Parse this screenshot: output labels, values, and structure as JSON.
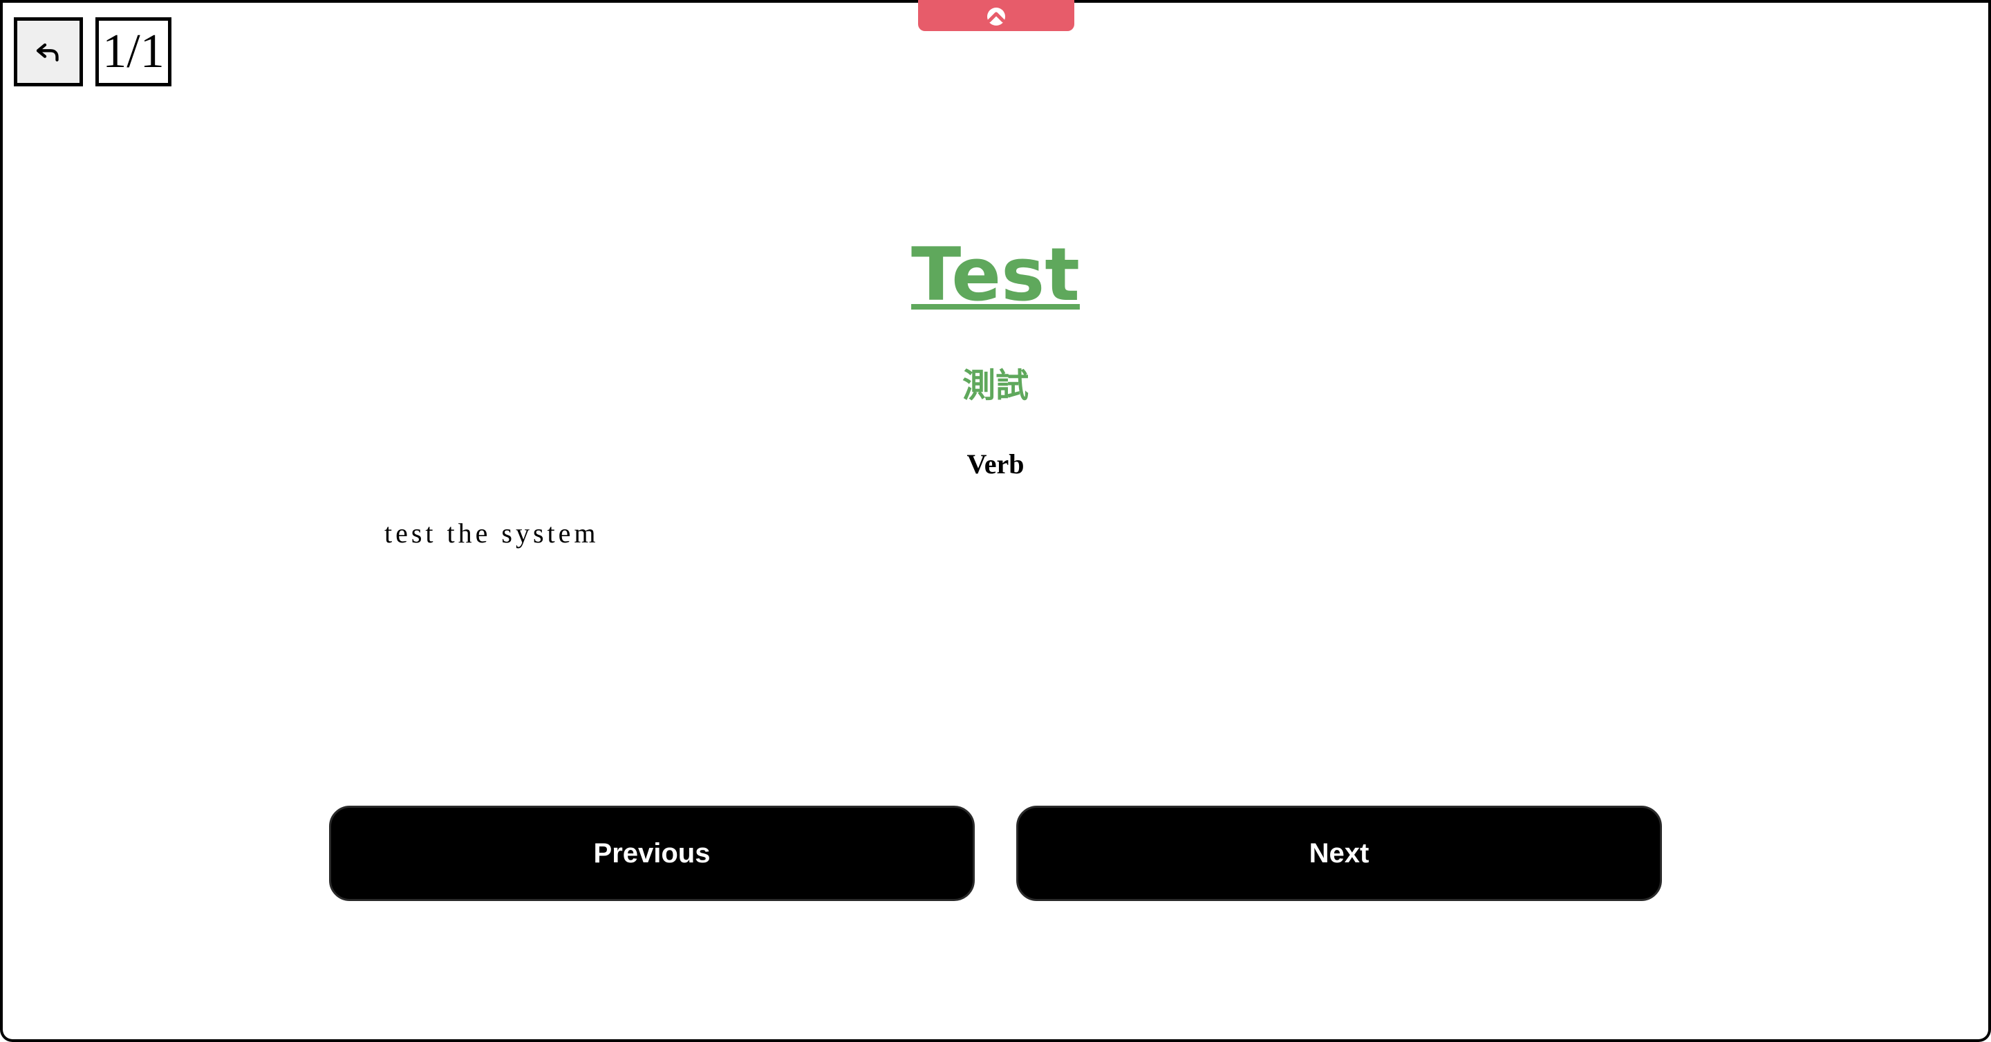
{
  "header": {
    "back_icon": "undo-arrow-icon",
    "page_counter": "1/1",
    "top_tab_icon": "chevron-up-icon",
    "top_tab_color": "#e75c6a"
  },
  "card": {
    "word": "Test",
    "translation": "測試",
    "part_of_speech": "Verb",
    "definition": "test the system",
    "accent_color": "#5fa85c"
  },
  "navigation": {
    "previous_label": "Previous",
    "next_label": "Next"
  }
}
